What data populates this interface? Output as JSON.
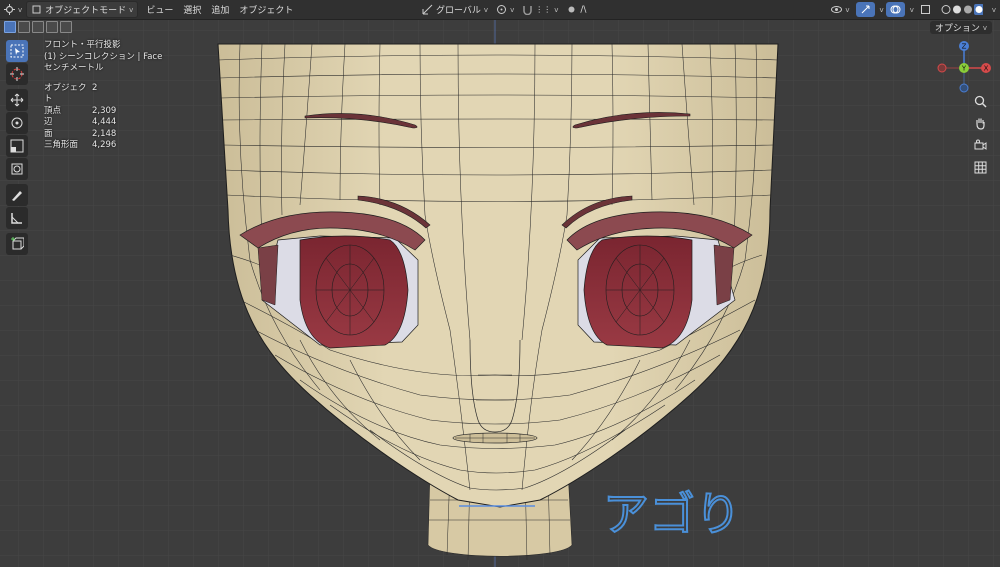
{
  "header": {
    "mode_label": "オブジェクトモード",
    "menus": [
      "ビュー",
      "選択",
      "追加",
      "オブジェクト"
    ],
    "transform_orientation": "グローバル"
  },
  "options_label": "オプション",
  "overlay": {
    "view_name": "フロント・平行投影",
    "collection_line": "(1) シーンコレクション | Face",
    "units": "センチメートル",
    "stats": [
      {
        "label": "オブジェクト",
        "value": "2"
      },
      {
        "label": "頂点",
        "value": "2,309"
      },
      {
        "label": "辺",
        "value": "4,444"
      },
      {
        "label": "面",
        "value": "2,148"
      },
      {
        "label": "三角形面",
        "value": "4,296"
      }
    ]
  },
  "gizmo": {
    "x": "X",
    "y": "Y",
    "z": "Z"
  },
  "annotation_text": "アゴり",
  "colors": {
    "header_bg": "#303030",
    "viewport_bg": "#3d3d3d",
    "skin": "#dccfac",
    "iris": "#8a2b34",
    "annotation": "#4a90d9",
    "active_tool": "#4a74b8"
  },
  "icons": [
    "editor-type-icon",
    "object-mode-icon",
    "transform-icon",
    "snap-icon",
    "proportional-icon",
    "visibility-icon",
    "gizmo-icon",
    "overlay-icon",
    "xray-icon",
    "shading-icons",
    "select-box-icon",
    "cursor-icon",
    "move-icon",
    "rotate-icon",
    "scale-icon",
    "transform-tool-icon",
    "annotate-icon",
    "measure-icon",
    "add-cube-icon",
    "zoom-icon",
    "hand-icon",
    "camera-icon",
    "grid-icon"
  ]
}
